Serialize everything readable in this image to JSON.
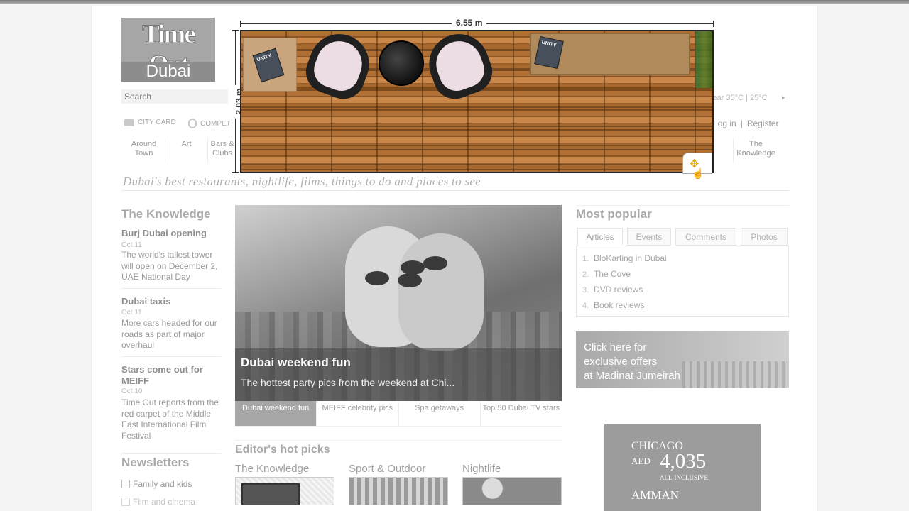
{
  "logo": {
    "brand": "Time Out",
    "city": "Dubai"
  },
  "search": {
    "placeholder": "Search"
  },
  "weather": {
    "text": "lear 35°C | 25°C",
    "arrow": "▸"
  },
  "toolbar": {
    "city_card": "CITY CARD",
    "competitions": "COMPET"
  },
  "auth": {
    "login": "Log in",
    "sep": "|",
    "register": "Register"
  },
  "nav": {
    "around": "Around Town",
    "art": "Art",
    "bars": "Bars & Clubs",
    "knowledge": "The Knowledge"
  },
  "tagline": "Dubai's best restaurants, nightlife, films, things to do and places to see",
  "knowledge": {
    "title": "The Knowledge",
    "items": [
      {
        "head": "Burj Dubai opening",
        "date": "Oct 11",
        "body": "The world's tallest tower will open on December 2, UAE National Day"
      },
      {
        "head": "Dubai taxis",
        "date": "Oct 11",
        "body": "More cars headed for our roads as part of major overhaul"
      },
      {
        "head": "Stars come out for MEIFF",
        "date": "Oct 10",
        "body": "Time Out reports from the red carpet of the Middle East International Film Festival"
      }
    ]
  },
  "newsletters": {
    "title": "Newsletters",
    "items": [
      "Family and kids",
      "Film and cinema"
    ]
  },
  "feature": {
    "title": "Dubai weekend fun",
    "subtitle": "The hottest party pics from the weekend at Chi...",
    "tabs": [
      "Dubai weekend fun",
      "MEIFF celebrity pics",
      "Spa getaways",
      "Top 50 Dubai TV stars"
    ]
  },
  "editors": {
    "title": "Editor's hot picks",
    "cols": [
      "The Knowledge",
      "Sport & Outdoor",
      "Nightlife"
    ]
  },
  "popular": {
    "title": "Most popular",
    "tabs": [
      "Articles",
      "Events",
      "Comments",
      "Photos"
    ],
    "items": [
      {
        "n": "1.",
        "label": "BloKarting in Dubai"
      },
      {
        "n": "2.",
        "label": "The Cove"
      },
      {
        "n": "3.",
        "label": "DVD reviews"
      },
      {
        "n": "4.",
        "label": "Book reviews"
      }
    ]
  },
  "banner": {
    "line1": "Click here for",
    "line2": "exclusive offers",
    "line3": "at Madinat Jumeirah"
  },
  "ad": {
    "from": "CHICAGO",
    "currency": "AED",
    "price": "4,035",
    "note": "ALL-INCLUSIVE",
    "to": "AMMAN"
  },
  "room": {
    "width_label": "6.55 m",
    "height_label": "2.03 m",
    "mag_label": "UNITY",
    "move_icon": "✥",
    "cursor_icon": "☝"
  }
}
